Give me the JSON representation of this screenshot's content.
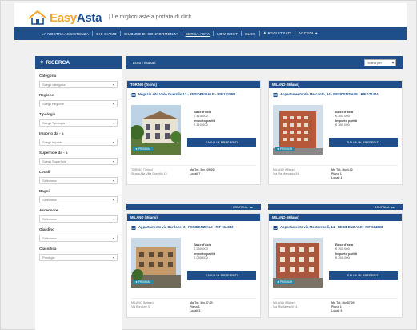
{
  "header": {
    "logo_easy": "Easy",
    "logo_asta": "Asta",
    "tagline": "| Le migliori aste a portata di click"
  },
  "nav": {
    "items": [
      "LA NOSTRA ASSISTENZA",
      "CHI SIAMO",
      "SIUDIZIO DI CONFORMENZA",
      "CERCA ASTA",
      "LOW COST",
      "BLOG",
      "REGISTRATI",
      "ACCEDI"
    ]
  },
  "sidebar": {
    "title": "RICERCA",
    "fields": [
      {
        "label": "Categoria",
        "value": "Scegli categoria"
      },
      {
        "label": "Regione",
        "value": "Scegli Regione"
      },
      {
        "label": "Tipologia",
        "value": "Scegli Tipologia"
      },
      {
        "label": "Importo da - a",
        "value": "Scegli importo"
      },
      {
        "label": "Superficie da - a",
        "value": "Scegli Superficie"
      },
      {
        "label": "Locali",
        "value": "Seleziona"
      },
      {
        "label": "Bagni",
        "value": "Seleziona"
      },
      {
        "label": "Ascensore",
        "value": "Seleziona"
      },
      {
        "label": "Giardino",
        "value": "Seleziona"
      },
      {
        "label": "Classifica",
        "value": "Prestigio"
      }
    ]
  },
  "results": {
    "title": "Ecco i risultati",
    "order_label": "Ordina per",
    "cards": [
      {
        "city": "TORINO (Torino)",
        "title": "Negozio sito Viale Guerrilio 13 - RESIDENZIALE - RIF 171590",
        "base_label": "Base d'asta",
        "base_value": "€ 410.000",
        "min_label": "Importo partiti",
        "min_value": "€ 410.000",
        "badge": "PREMIUM",
        "save_label": "SALVA IN PREFERITI",
        "foot_left_1": "TORINO (Torino)",
        "foot_left_2": "Strada Alla Villa Guerrilio 13",
        "foot_right_1": "Mq Tot. Mq 239,00",
        "foot_right_2": "Locali 7"
      },
      {
        "city": "MILANO (Milano)",
        "title": "Appartamento Via Mercanto, 34 - RESIDENZIALE - RIF 171474",
        "base_label": "Base d'asta",
        "base_value": "€ 350.000",
        "min_label": "Importo partiti",
        "min_value": "€ 350.000",
        "badge": "PREMIUM",
        "save_label": "SALVA IN PREFERITI",
        "foot_left_1": "MILANO (Milano)",
        "foot_left_2": "Via Via Mercanto 34",
        "foot_right_1": "Mq Tot. Mq 4,00",
        "foot_right_2": "Piano 1",
        "foot_right_3": "Locali 1"
      },
      {
        "city": "MILANO (Milano)",
        "title": "Appartamento via Bordone, 3 - RESIDENZIALE - RIF 514883",
        "base_label": "Base d'asta",
        "base_value": "€ 250.000",
        "min_label": "Importo partiti",
        "min_value": "€ 250.000",
        "badge": "PREMIUM",
        "save_label": "SALVA IN PREFERITI",
        "foot_left_1": "MILANO (Milano)",
        "foot_left_2": "Via Bordone 3",
        "foot_right_1": "Mq Tot. Mq 87,00",
        "foot_right_2": "Piano 1",
        "foot_right_3": "Locali 3"
      },
      {
        "city": "MILANO (Milano)",
        "title": "Appartamento via Montaresolli, 14 - RESIDENZIALE - RIF 514883",
        "base_label": "Base d'asta",
        "base_value": "€ 250.000",
        "min_label": "Importo partiti",
        "min_value": "€ 250.000",
        "badge": "PREMIUM",
        "save_label": "SALVA IN PREFERITI",
        "foot_left_1": "MILANO (Milano)",
        "foot_left_2": "Via Montaresolli 14",
        "foot_right_1": "Mq Tot. Mq 87,00",
        "foot_right_2": "Piano 1",
        "foot_right_3": "Locali 3"
      }
    ],
    "continue_label": "CONTINUA"
  },
  "colors": {
    "brand_blue": "#1e4f8a",
    "logo_orange": "#f0a830",
    "badge_teal": "#2a8aa0"
  }
}
